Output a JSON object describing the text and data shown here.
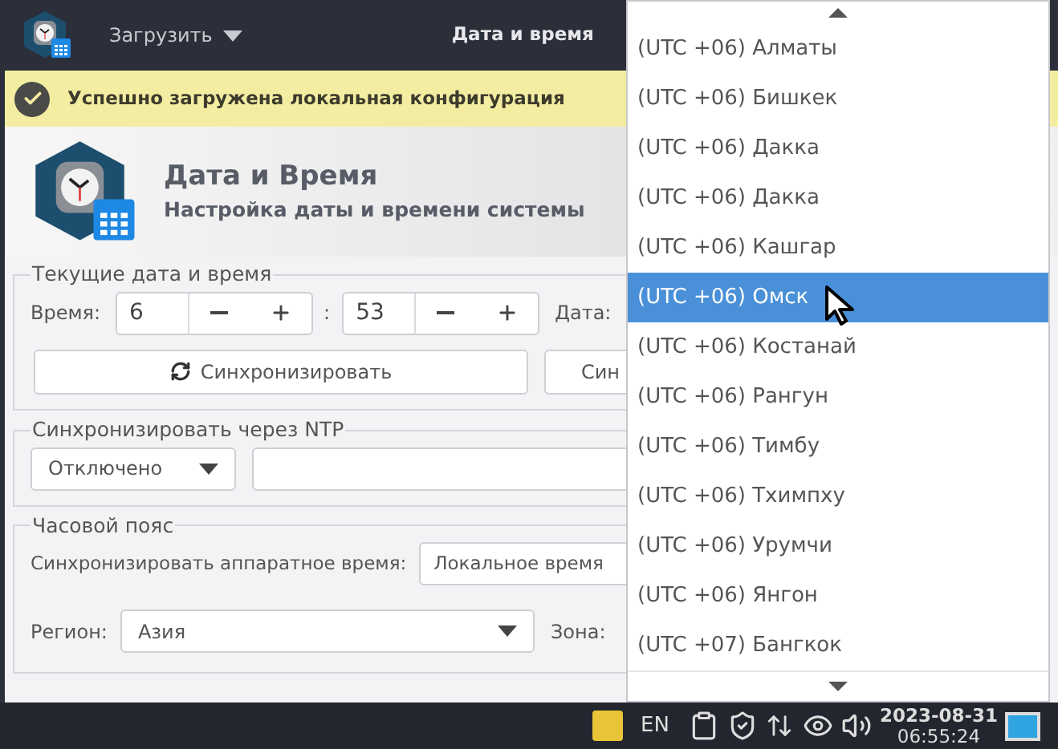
{
  "topbar": {
    "menu": "Загрузить",
    "title": "Дата и время"
  },
  "notification": {
    "text": "Успешно загружена локальная конфигурация"
  },
  "header": {
    "title": "Дата и Время",
    "subtitle": "Настройка даты и времени системы"
  },
  "current_datetime": {
    "legend": "Текущие дата и время",
    "time_label": "Время:",
    "hours": "6",
    "separator": ":",
    "minutes": "53",
    "date_label": "Дата:",
    "sync_button": "Синхронизировать",
    "second_button": "Син"
  },
  "ntp": {
    "legend": "Синхронизировать через NTP",
    "mode": "Отключено"
  },
  "timezone": {
    "legend": "Часовой пояс",
    "hw_label": "Синхронизировать аппаратное время:",
    "hw_value": "Локальное время",
    "region_label": "Регион:",
    "region": "Азия",
    "zone_label": "Зона:"
  },
  "zone_dropdown": {
    "items": [
      {
        "label": "(UTC +06) Алматы",
        "selected": false
      },
      {
        "label": "(UTC +06) Бишкек",
        "selected": false
      },
      {
        "label": "(UTC +06) Дакка",
        "selected": false
      },
      {
        "label": "(UTC +06) Дакка",
        "selected": false
      },
      {
        "label": "(UTC +06) Кашгар",
        "selected": false
      },
      {
        "label": "(UTC +06) Омск",
        "selected": true
      },
      {
        "label": "(UTC +06) Костанай",
        "selected": false
      },
      {
        "label": "(UTC +06) Рангун",
        "selected": false
      },
      {
        "label": "(UTC +06) Тимбу",
        "selected": false
      },
      {
        "label": "(UTC +06) Тхимпху",
        "selected": false
      },
      {
        "label": "(UTC +06) Урумчи",
        "selected": false
      },
      {
        "label": "(UTC +06) Янгон",
        "selected": false
      },
      {
        "label": "(UTC +07) Бангкок",
        "selected": false
      }
    ]
  },
  "taskbar": {
    "language": "EN",
    "date": "2023-08-31",
    "time": "06:55:24"
  }
}
